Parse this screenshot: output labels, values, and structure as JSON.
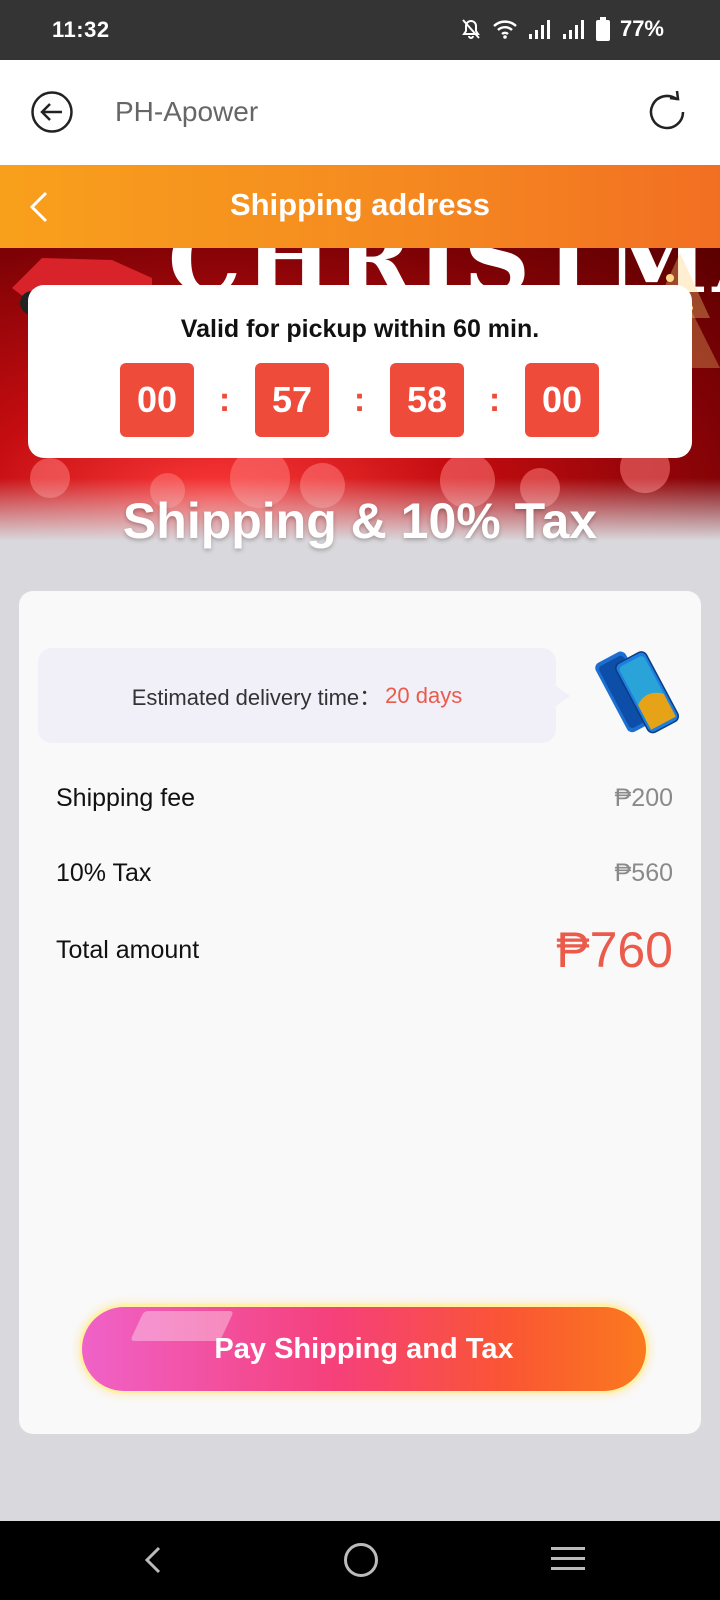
{
  "status_bar": {
    "time": "11:32",
    "battery": "77%"
  },
  "browser": {
    "title": "PH-Apower"
  },
  "header": {
    "title": "Shipping address"
  },
  "banner": {
    "word": "CHRISTMAS"
  },
  "timer": {
    "caption": "Valid for pickup within 60 min.",
    "hours": "00",
    "minutes": "57",
    "seconds": "58",
    "centis": "00",
    "separator": ":"
  },
  "section_title": "Shipping & 10% Tax",
  "delivery": {
    "label": "Estimated delivery time：",
    "value": "20 days"
  },
  "fees": [
    {
      "label": "Shipping fee",
      "value": "₱200"
    },
    {
      "label": "10% Tax",
      "value": "₱560"
    }
  ],
  "total": {
    "label": "Total amount",
    "value": "₱760"
  },
  "pay_button": {
    "label": "Pay Shipping and Tax"
  },
  "colors": {
    "accent_orange": "#f58a20",
    "accent_red": "#ee4b3b",
    "price_red": "#ea5b4b"
  }
}
